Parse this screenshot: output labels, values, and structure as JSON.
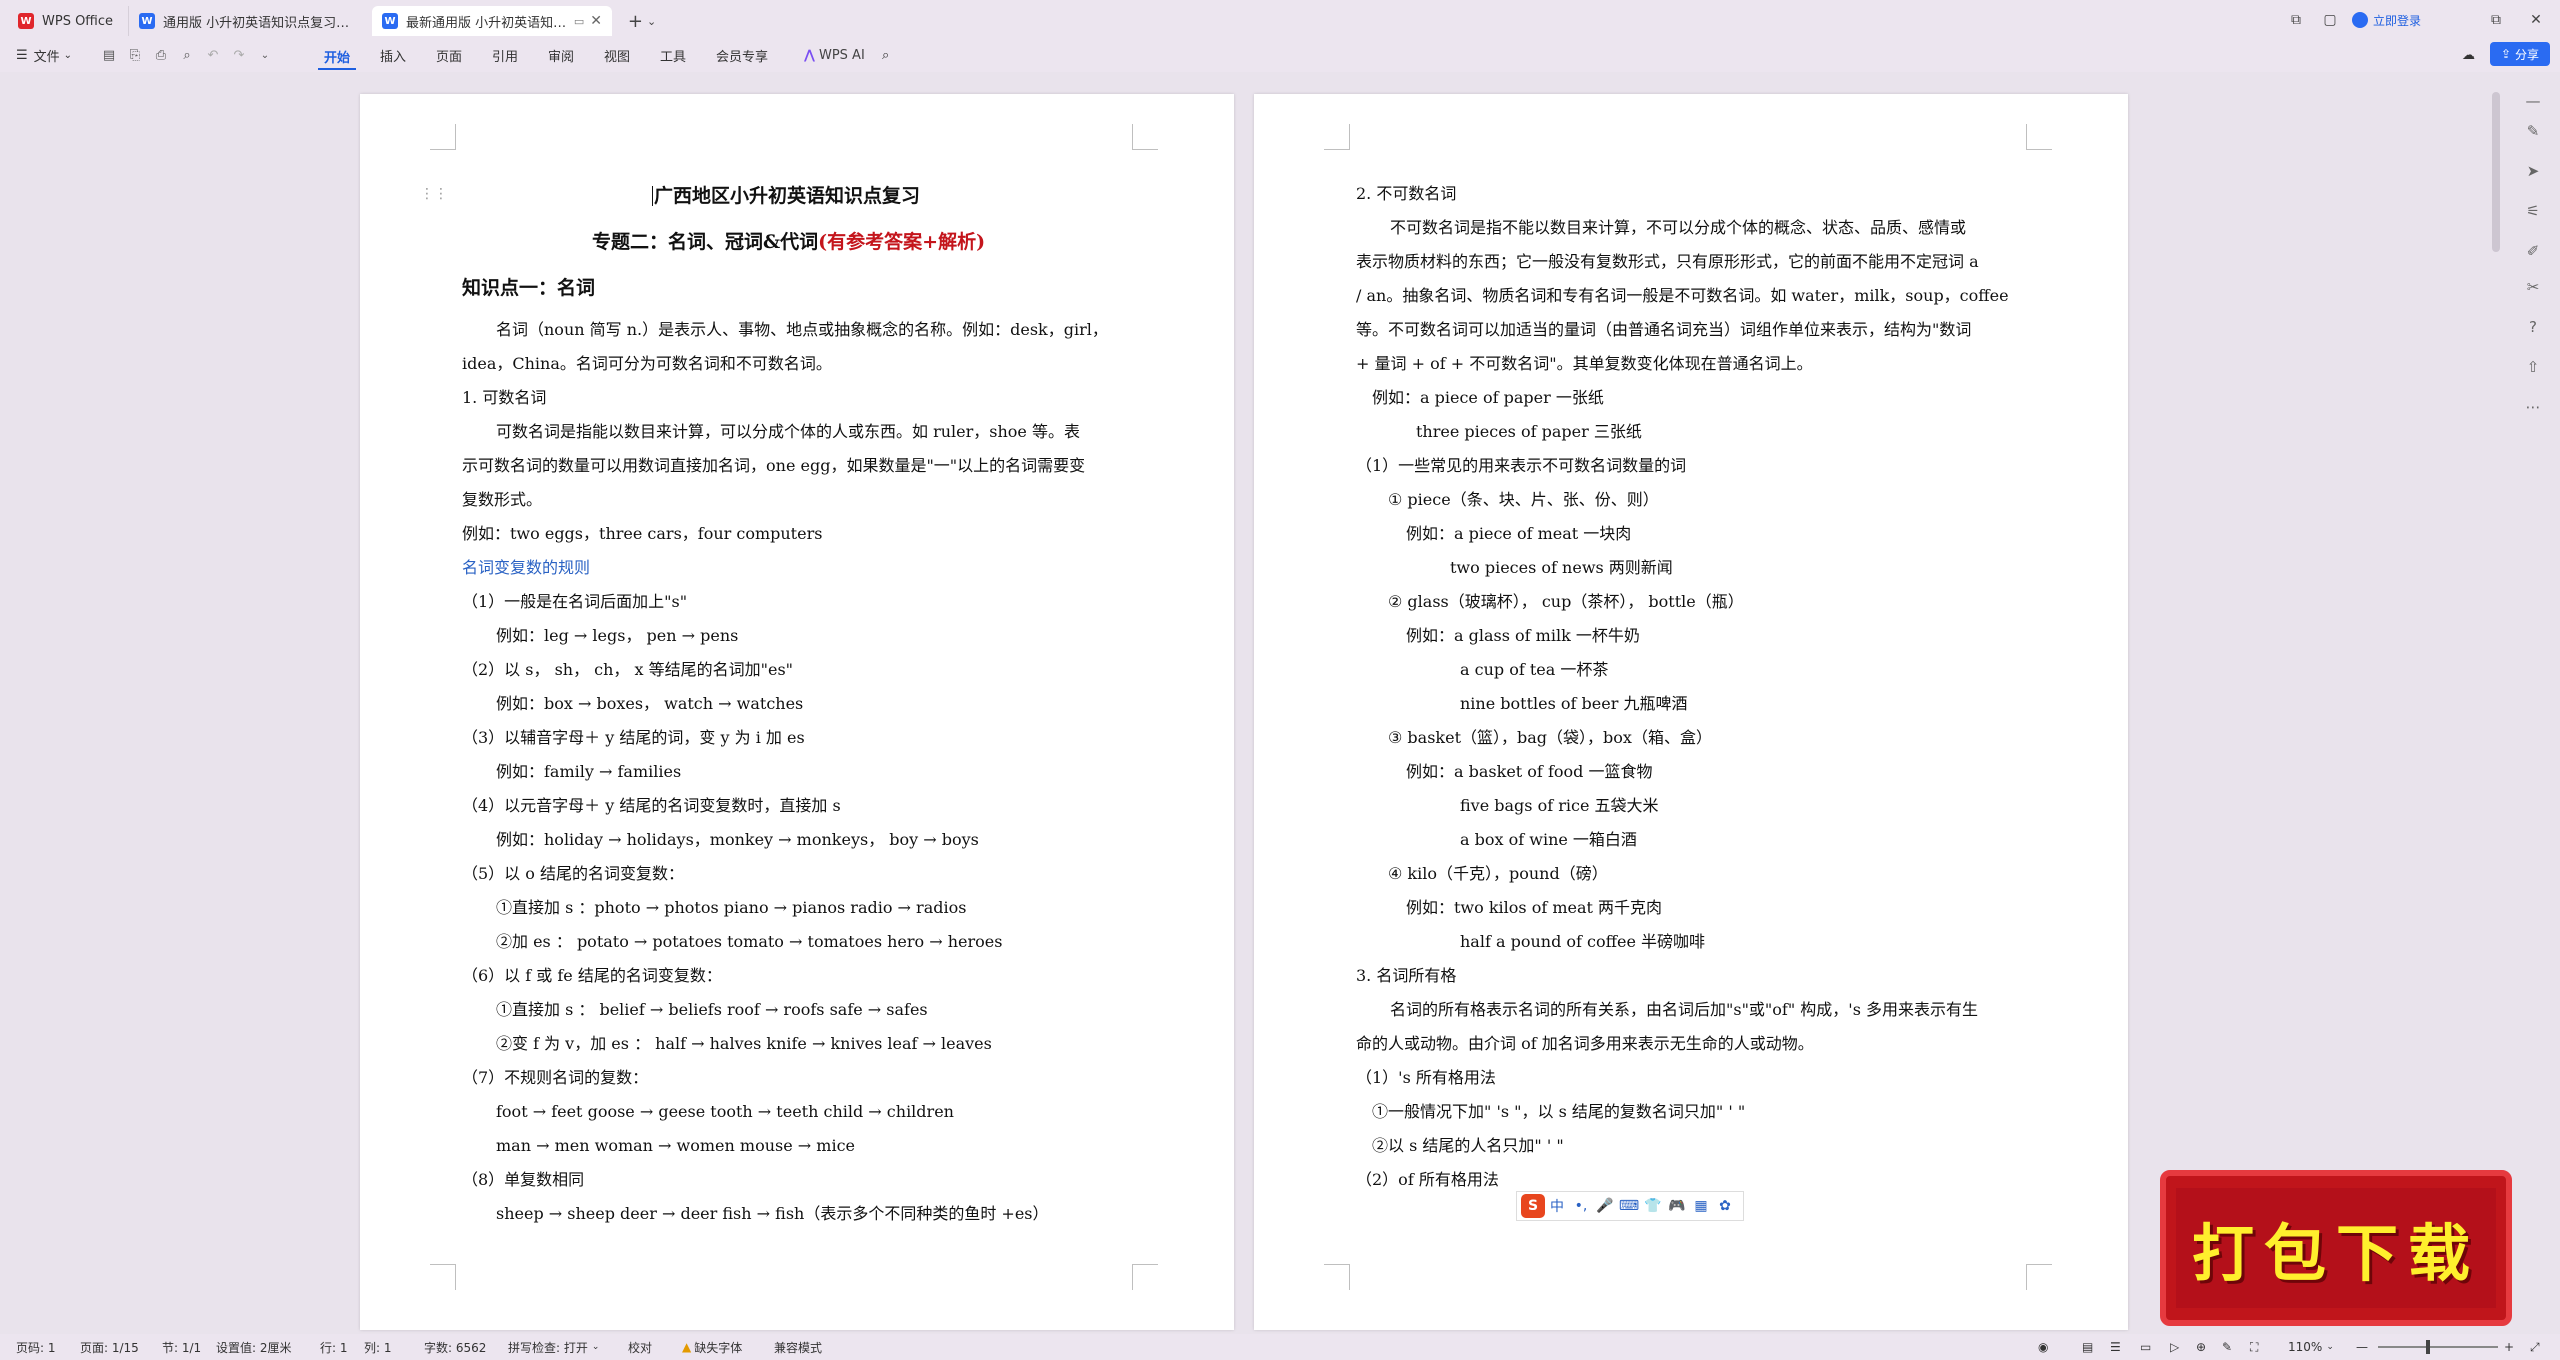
{
  "titlebar": {
    "tabs": [
      {
        "label": "WPS Office",
        "icon": "wps-logo-icon"
      },
      {
        "label": "通用版 小升初英语知识点复习专题1...",
        "icon": "word-doc-icon"
      },
      {
        "label": "最新通用版 小升初英语知识点...",
        "icon": "word-doc-icon"
      }
    ],
    "login": "立即登录",
    "new_tab": "+",
    "tab_menu": "⌄"
  },
  "ribbon": {
    "file": "文件",
    "menus": [
      "开始",
      "插入",
      "页面",
      "引用",
      "审阅",
      "视图",
      "工具",
      "会员专享"
    ],
    "active_menu": "开始",
    "wps_ai": "WPS AI",
    "share": "分享"
  },
  "page_left": {
    "title": "广西地区小升初英语知识点复习",
    "subtitle_black": "专题二：名词、冠词&代词",
    "subtitle_red": "(有参考答案+解析)",
    "kp": "知识点一：名词",
    "lines": [
      "名词（noun 简写 n.）是表示人、事物、地点或抽象概念的名称。例如：desk，girl，",
      "idea，China。名词可分为可数名词和不可数名词。",
      "1. 可数名词",
      "可数名词是指能以数目来计算，可以分成个体的人或东西。如 ruler，shoe 等。表",
      "示可数名词的数量可以用数词直接加名词，one egg，如果数量是\"一\"以上的名词需要变",
      "复数形式。",
      "例如：two eggs，three cars，four computers",
      "名词变复数的规则",
      "（1）一般是在名词后面加上\"s\"",
      "例如：leg → legs，  pen → pens",
      "（2）以 s， sh， ch， x 等结尾的名词加\"es\"",
      "例如：box → boxes，  watch → watches",
      "（3）以辅音字母＋ y 结尾的词，变 y 为 i 加 es",
      "例如：family → families",
      "（4）以元音字母＋ y 结尾的名词变复数时，直接加 s",
      "例如：holiday → holidays，monkey → monkeys，  boy → boys",
      "（5）以 o 结尾的名词变复数：",
      "①直接加 s ：photo → photos    piano → pianos   radio → radios",
      "②加 es ：  potato → potatoes   tomato → tomatoes   hero → heroes",
      "（6）以 f 或 fe 结尾的名词变复数：",
      "①直接加 s ：  belief → beliefs   roof → roofs   safe → safes",
      "②变 f 为 v，加 es ：  half → halves   knife → knives   leaf → leaves",
      "（7）不规则名词的复数：",
      "foot → feet goose → geese tooth → teeth  child → children",
      "man → men woman → women mouse → mice",
      "（8）单复数相同",
      "sheep → sheep   deer → deer   fish → fish（表示多个不同种类的鱼时 +es）"
    ]
  },
  "page_right": {
    "lines": [
      "2. 不可数名词",
      "不可数名词是指不能以数目来计算，不可以分成个体的概念、状态、品质、感情或",
      "表示物质材料的东西；它一般没有复数形式，只有原形形式，它的前面不能用不定冠词 a",
      "/ an。抽象名词、物质名词和专有名词一般是不可数名词。如 water，milk，soup，coffee",
      "等。不可数名词可以加适当的量词（由普通名词充当）词组作单位来表示，结构为\"数词",
      "+ 量词 + of + 不可数名词\"。其单复数变化体现在普通名词上。",
      "例如：a piece of paper 一张纸",
      "three pieces of paper 三张纸",
      "（1）一些常见的用来表示不可数名词数量的词",
      "① piece（条、块、片、张、份、则）",
      "例如：a piece of meat 一块肉",
      "two pieces of news 两则新闻",
      "② glass（玻璃杯），  cup（茶杯），  bottle（瓶）",
      "例如：a glass of milk 一杯牛奶",
      "a cup of tea 一杯茶",
      "nine bottles of beer 九瓶啤酒",
      "③ basket（篮），bag（袋），box（箱、盒）",
      "例如：a basket of food 一篮食物",
      "five bags of rice 五袋大米",
      "a box of wine 一箱白酒",
      "④ kilo（千克），pound（磅）",
      "例如：two kilos of meat 两千克肉",
      "half a pound of coffee 半磅咖啡",
      "3. 名词所有格",
      "名词的所有格表示名词的所有关系，由名词后加\"s\"或\"of\" 构成，'s 多用来表示有生",
      "命的人或动物。由介词 of 加名词多用来表示无生命的人或动物。",
      "（1）'s 所有格用法",
      "①一般情况下加\" 's \"，以 s 结尾的复数名词只加\" ' \"",
      "②以 s 结尾的人名只加\" ' \"",
      "（2）of 所有格用法"
    ]
  },
  "ime": {
    "logo": "S",
    "items": [
      "中",
      "•,",
      "🎤",
      "⌨",
      "👕",
      "🎮",
      "▦",
      "✿"
    ]
  },
  "promo": {
    "text": "打包下载"
  },
  "statusbar": {
    "page_no": "页码: 1",
    "pages": "页面: 1/15",
    "section": "节: 1/1",
    "setting": "设置值: 2厘米",
    "row": "行: 1",
    "col": "列: 1",
    "words": "字数: 6562",
    "spell": "拼写检查: 打开",
    "proof": "校对",
    "missing_font": "缺失字体",
    "compat": "兼容模式",
    "zoom": "110%"
  }
}
